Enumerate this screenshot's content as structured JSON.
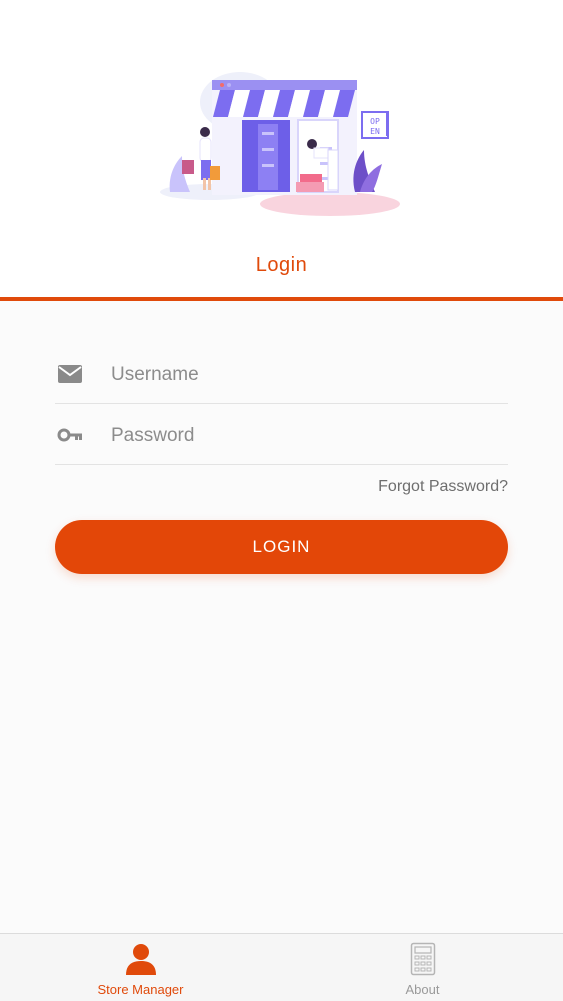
{
  "illustration": {
    "sign_text_line1": "OP",
    "sign_text_line2": "EN"
  },
  "tabs": {
    "login_label": "Login"
  },
  "form": {
    "username_placeholder": "Username",
    "password_placeholder": "Password",
    "forgot_label": "Forgot Password?",
    "submit_label": "LOGIN"
  },
  "bottom_nav": {
    "items": [
      {
        "label": "Store Manager",
        "icon": "person-icon",
        "active": true
      },
      {
        "label": "About",
        "icon": "calculator-icon",
        "active": false
      }
    ]
  },
  "colors": {
    "accent": "#e04a0b",
    "illustration_purple": "#7c6df0",
    "illustration_pink": "#f7c9d6"
  }
}
